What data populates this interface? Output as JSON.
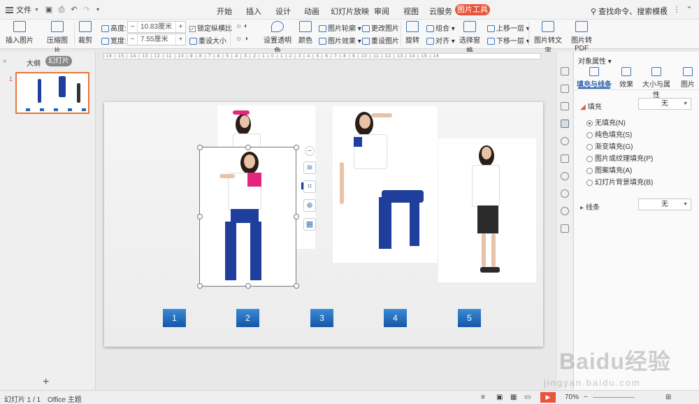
{
  "menubar": {
    "file_label": "文件",
    "tabs": [
      "开始",
      "插入",
      "设计",
      "动画",
      "幻灯片放映",
      "审阅",
      "视图",
      "云服务"
    ],
    "active_tab": "图片工具",
    "search_placeholder": "查找命令、搜索模板"
  },
  "ribbon": {
    "insert_picture": "插入图片",
    "compress_picture": "压缩图片",
    "crop": "裁剪",
    "height_label": "高度:",
    "height_value": "10.83厘米",
    "width_label": "宽度:",
    "width_value": "7.55厘米",
    "lock_ratio": "锁定纵横比",
    "reset_size": "重设大小",
    "set_transparent": "设置透明色",
    "color": "颜色",
    "picture_outline": "图片轮廓",
    "picture_effect": "图片效果",
    "change_picture": "更改图片",
    "reset_picture": "重设图片",
    "rotate": "旋转",
    "group": "组合",
    "align": "对齐",
    "selection_pane": "选择窗格",
    "bring_forward": "上移一层",
    "send_backward": "下移一层",
    "to_text": "图片转文字",
    "to_pdf": "图片转PDF"
  },
  "leftpanel": {
    "outline_tab": "大纲",
    "slides_tab": "幻灯片",
    "slide_number": "1"
  },
  "slide": {
    "numbers": [
      "1",
      "2",
      "3",
      "4",
      "5"
    ]
  },
  "props": {
    "title": "对象属性",
    "tabs": [
      "填充与线条",
      "效果",
      "大小与属性",
      "图片"
    ],
    "fill_section": "填充",
    "fill_value": "无",
    "fill_options": [
      "无填充(N)",
      "纯色填充(S)",
      "渐变填充(G)",
      "图片或纹理填充(P)",
      "图案填充(A)",
      "幻灯片背景填充(B)"
    ],
    "line_section": "线条",
    "line_value": "无"
  },
  "statusbar": {
    "slide_count": "幻灯片 1 / 1",
    "theme": "Office 主题",
    "zoom": "70%"
  },
  "watermark": {
    "brand": "Baidu经验",
    "url": "jingyan.baidu.com"
  },
  "colors": {
    "accent": "#e8553a",
    "number_box": "#1e6bbf",
    "pants": "#203f9c"
  }
}
